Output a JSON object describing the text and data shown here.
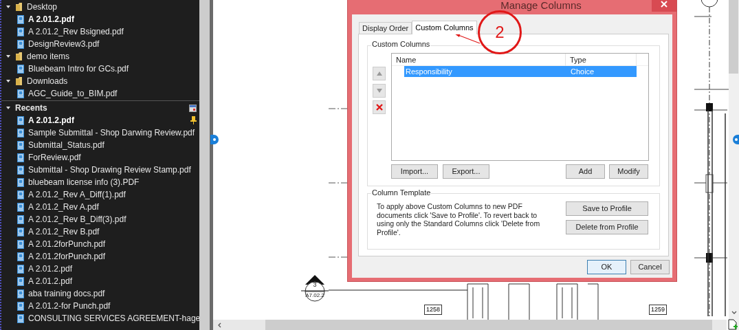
{
  "folders": [
    {
      "label": "Desktop",
      "expanded": true,
      "children": [
        {
          "label": "A 2.01.2.pdf",
          "active": true
        },
        {
          "label": "A 2.01.2_Rev Bsigned.pdf",
          "active": false
        },
        {
          "label": "DesignReview3.pdf",
          "active": false
        }
      ]
    },
    {
      "label": "demo items",
      "expanded": true,
      "children": [
        {
          "label": "Bluebeam Intro for GCs.pdf",
          "active": false
        }
      ]
    },
    {
      "label": "Downloads",
      "expanded": true,
      "children": [
        {
          "label": "AGC_Guide_to_BIM.pdf",
          "active": false
        }
      ]
    }
  ],
  "recents": {
    "label": "Recents",
    "expanded": true,
    "items": [
      {
        "label": "A 2.01.2.pdf",
        "active": true,
        "pinned": true
      },
      {
        "label": "Sample Submittal - Shop Darwing Review.pdf",
        "active": false,
        "pinned": false
      },
      {
        "label": "Submittal_Status.pdf",
        "active": false,
        "pinned": false
      },
      {
        "label": "ForReview.pdf",
        "active": false,
        "pinned": false
      },
      {
        "label": "Submittal - Shop Drawing Review Stamp.pdf",
        "active": false,
        "pinned": false
      },
      {
        "label": "bluebeam license info (3).PDF",
        "active": false,
        "pinned": false
      },
      {
        "label": "A 2.01.2_Rev A_Diff(1).pdf",
        "active": false,
        "pinned": false
      },
      {
        "label": "A 2.01.2_Rev A.pdf",
        "active": false,
        "pinned": false
      },
      {
        "label": "A 2.01.2_Rev B_Diff(3).pdf",
        "active": false,
        "pinned": false
      },
      {
        "label": "A 2.01.2_Rev B.pdf",
        "active": false,
        "pinned": false
      },
      {
        "label": "A 2.01.2forPunch.pdf",
        "active": false,
        "pinned": false
      },
      {
        "label": "A 2.01.2forPunch.pdf",
        "active": false,
        "pinned": false
      },
      {
        "label": "A 2.01.2.pdf",
        "active": false,
        "pinned": false
      },
      {
        "label": "A 2.01.2.pdf",
        "active": false,
        "pinned": false
      },
      {
        "label": "aba training docs.pdf",
        "active": false,
        "pinned": false
      },
      {
        "label": "A 2.01.2-for Punch.pdf",
        "active": false,
        "pinned": false
      },
      {
        "label": "CONSULTING SERVICES AGREEMENT-hage",
        "active": false,
        "pinned": false
      }
    ]
  },
  "drawing": {
    "section_number": "3",
    "section_sheet": "A7.02.2",
    "room_tags": [
      "1258",
      "1259"
    ]
  },
  "dialog": {
    "title": "Manage Columns",
    "tabs": [
      {
        "label": "Display Order",
        "selected": false
      },
      {
        "label": "Custom Columns",
        "selected": true
      }
    ],
    "custom_columns": {
      "legend": "Custom Columns",
      "columns": [
        "Name",
        "Type"
      ],
      "rows": [
        {
          "name": "Responsibility",
          "type": "Choice",
          "selected": true
        }
      ],
      "buttons": [
        "Import...",
        "Export...",
        "Add",
        "Modify"
      ]
    },
    "column_template": {
      "legend": "Column Template",
      "text": "To apply above Custom Columns to new PDF documents click 'Save to Profile'. To revert back to using only the Standard Columns click 'Delete from Profile'.",
      "buttons": [
        "Save to Profile",
        "Delete from Profile"
      ]
    },
    "buttons": [
      "OK",
      "Cancel"
    ]
  },
  "annotation": {
    "label": "2"
  }
}
